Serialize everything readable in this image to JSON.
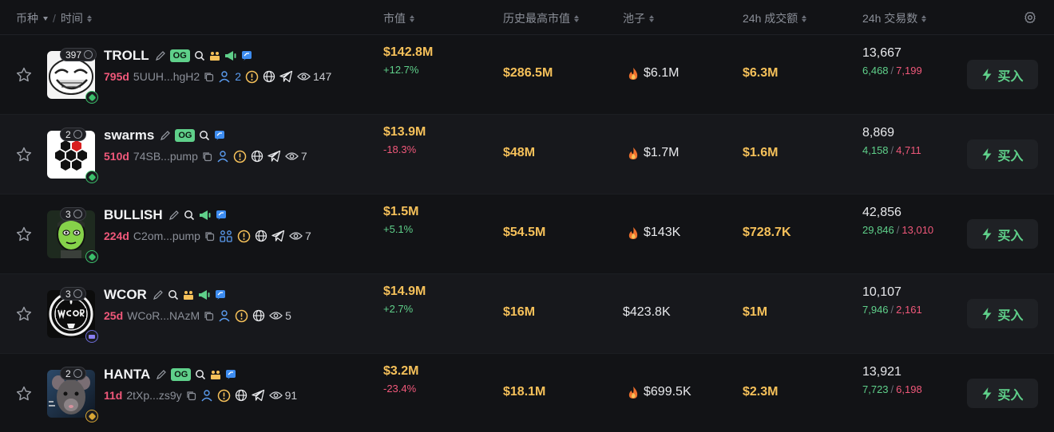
{
  "header": {
    "coin": "币种",
    "time": "时间",
    "mcap": "市值",
    "ath": "历史最高市值",
    "pool": "池子",
    "volume": "24h 成交额",
    "txs": "24h 交易数"
  },
  "rows": [
    {
      "name": "TROLL",
      "holders": "397",
      "og": "OG",
      "age": "795d",
      "address": "5UUH...hgH2",
      "devs": "2",
      "views": "147",
      "mcap": "$142.8M",
      "change": "+12.7%",
      "ath": "$286.5M",
      "pool": "$6.1M",
      "volume": "$6.3M",
      "txs": "13,667",
      "buys": "6,468",
      "sells": "7,199",
      "buy_label": "买入"
    },
    {
      "name": "swarms",
      "holders": "2",
      "og": "OG",
      "age": "510d",
      "address": "74SB...pump",
      "views": "7",
      "mcap": "$13.9M",
      "change": "-18.3%",
      "ath": "$48M",
      "pool": "$1.7M",
      "volume": "$1.6M",
      "txs": "8,869",
      "buys": "4,158",
      "sells": "4,711",
      "buy_label": "买入"
    },
    {
      "name": "BULLISH",
      "holders": "3",
      "age": "224d",
      "address": "C2om...pump",
      "views": "7",
      "mcap": "$1.5M",
      "change": "+5.1%",
      "ath": "$54.5M",
      "pool": "$143K",
      "volume": "$728.7K",
      "txs": "42,856",
      "buys": "29,846",
      "sells": "13,010",
      "buy_label": "买入"
    },
    {
      "name": "WCOR",
      "holders": "3",
      "age": "25d",
      "address": "WCoR...NAzM",
      "views": "5",
      "mcap": "$14.9M",
      "change": "+2.7%",
      "ath": "$16M",
      "pool": "$423.8K",
      "volume": "$1M",
      "txs": "10,107",
      "buys": "7,946",
      "sells": "2,161",
      "buy_label": "买入"
    },
    {
      "name": "HANTA",
      "holders": "2",
      "og": "OG",
      "age": "11d",
      "address": "2tXp...zs9y",
      "views": "91",
      "mcap": "$3.2M",
      "change": "-23.4%",
      "ath": "$18.1M",
      "pool": "$699.5K",
      "volume": "$2.3M",
      "txs": "13,921",
      "buys": "7,723",
      "sells": "6,198",
      "buy_label": "买入"
    }
  ],
  "colors": {
    "accent_yellow": "#f6c15a",
    "positive": "#5fd08a",
    "negative": "#f0587a",
    "link_blue": "#5b9cf0"
  }
}
